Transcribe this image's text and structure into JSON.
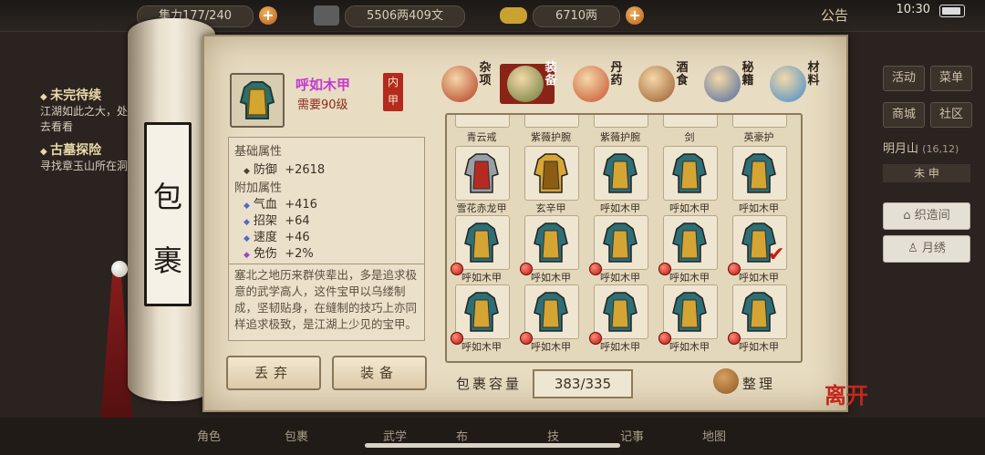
{
  "status": {
    "capacity_text": "集力177/240",
    "money": "5506两409文",
    "gold": "6710两",
    "announce": "公告",
    "clock": "10:30"
  },
  "quests": [
    {
      "title": "未完待续",
      "text": "江湖如此之大，处去看看"
    },
    {
      "title": "古墓探险",
      "text": "寻找章玉山所在洞"
    }
  ],
  "side_menu": {
    "buttons": [
      "活动",
      "菜单",
      "商城",
      "社区"
    ],
    "location": "明月山",
    "coords": "(16,12)",
    "time": "未 申",
    "long_buttons": [
      "织造间",
      "月绣"
    ]
  },
  "scroll": {
    "char1": "包",
    "char2": "裹"
  },
  "item": {
    "name": "呼如木甲",
    "requirement": "需要90级",
    "seal": "内甲",
    "base_title": "基础属性",
    "base_stats": [
      {
        "name": "防御",
        "value": "+2618"
      }
    ],
    "extra_title": "附加属性",
    "extra_stats": [
      {
        "name": "气血",
        "value": "+416",
        "color": "blue"
      },
      {
        "name": "招架",
        "value": "+64",
        "color": "blue"
      },
      {
        "name": "速度",
        "value": "+46",
        "color": "blue"
      },
      {
        "name": "免伤",
        "value": "+2%",
        "color": "purple"
      }
    ],
    "description": "塞北之地历来群侠辈出，多是追求极意的武学高人，这件宝甲以乌缕制成，坚韧贴身，在缝制的技巧上亦同样追求极致，是江湖上少见的宝甲。"
  },
  "actions": {
    "discard": "丢弃",
    "equip": "装备"
  },
  "tabs": [
    {
      "label": "杂项",
      "active": false,
      "color": "#b33a22"
    },
    {
      "label": "装备",
      "active": true,
      "color": "#6a7a3a"
    },
    {
      "label": "丹药",
      "active": false,
      "color": "#c7502c"
    },
    {
      "label": "酒食",
      "active": false,
      "color": "#9a5a2c"
    },
    {
      "label": "秘籍",
      "active": false,
      "color": "#4a6aa0"
    },
    {
      "label": "材料",
      "active": false,
      "color": "#3f8ccc"
    }
  ],
  "grid_top_labels": [
    "青云戒",
    "紫薇护腕",
    "紫薇护腕",
    "剑",
    "英豪护"
  ],
  "grid_rows": [
    [
      {
        "label": "雪花赤龙甲",
        "kind": "red",
        "dot": false,
        "check": false
      },
      {
        "label": "玄辛甲",
        "kind": "gold",
        "dot": false,
        "check": false
      },
      {
        "label": "呼如木甲",
        "kind": "teal",
        "dot": false,
        "check": false
      },
      {
        "label": "呼如木甲",
        "kind": "teal",
        "dot": false,
        "check": false
      },
      {
        "label": "呼如木甲",
        "kind": "teal",
        "dot": false,
        "check": false
      }
    ],
    [
      {
        "label": "呼如木甲",
        "kind": "teal",
        "dot": true,
        "check": false
      },
      {
        "label": "呼如木甲",
        "kind": "teal",
        "dot": true,
        "check": false
      },
      {
        "label": "呼如木甲",
        "kind": "teal",
        "dot": true,
        "check": false
      },
      {
        "label": "呼如木甲",
        "kind": "teal",
        "dot": true,
        "check": false
      },
      {
        "label": "呼如木甲",
        "kind": "teal",
        "dot": true,
        "check": true
      }
    ],
    [
      {
        "label": "呼如木甲",
        "kind": "teal",
        "dot": true,
        "check": false
      },
      {
        "label": "呼如木甲",
        "kind": "teal",
        "dot": true,
        "check": false
      },
      {
        "label": "呼如木甲",
        "kind": "teal",
        "dot": true,
        "check": false
      },
      {
        "label": "呼如木甲",
        "kind": "teal",
        "dot": true,
        "check": false
      },
      {
        "label": "呼如木甲",
        "kind": "teal",
        "dot": true,
        "check": false
      }
    ]
  ],
  "capacity": {
    "label": "包裹容量",
    "value": "383/335"
  },
  "sort_label": "整理",
  "leave_label": "离开",
  "bottom_nav": [
    "角色",
    "包裹",
    "武学",
    "布",
    "技",
    "记事",
    "地图"
  ]
}
